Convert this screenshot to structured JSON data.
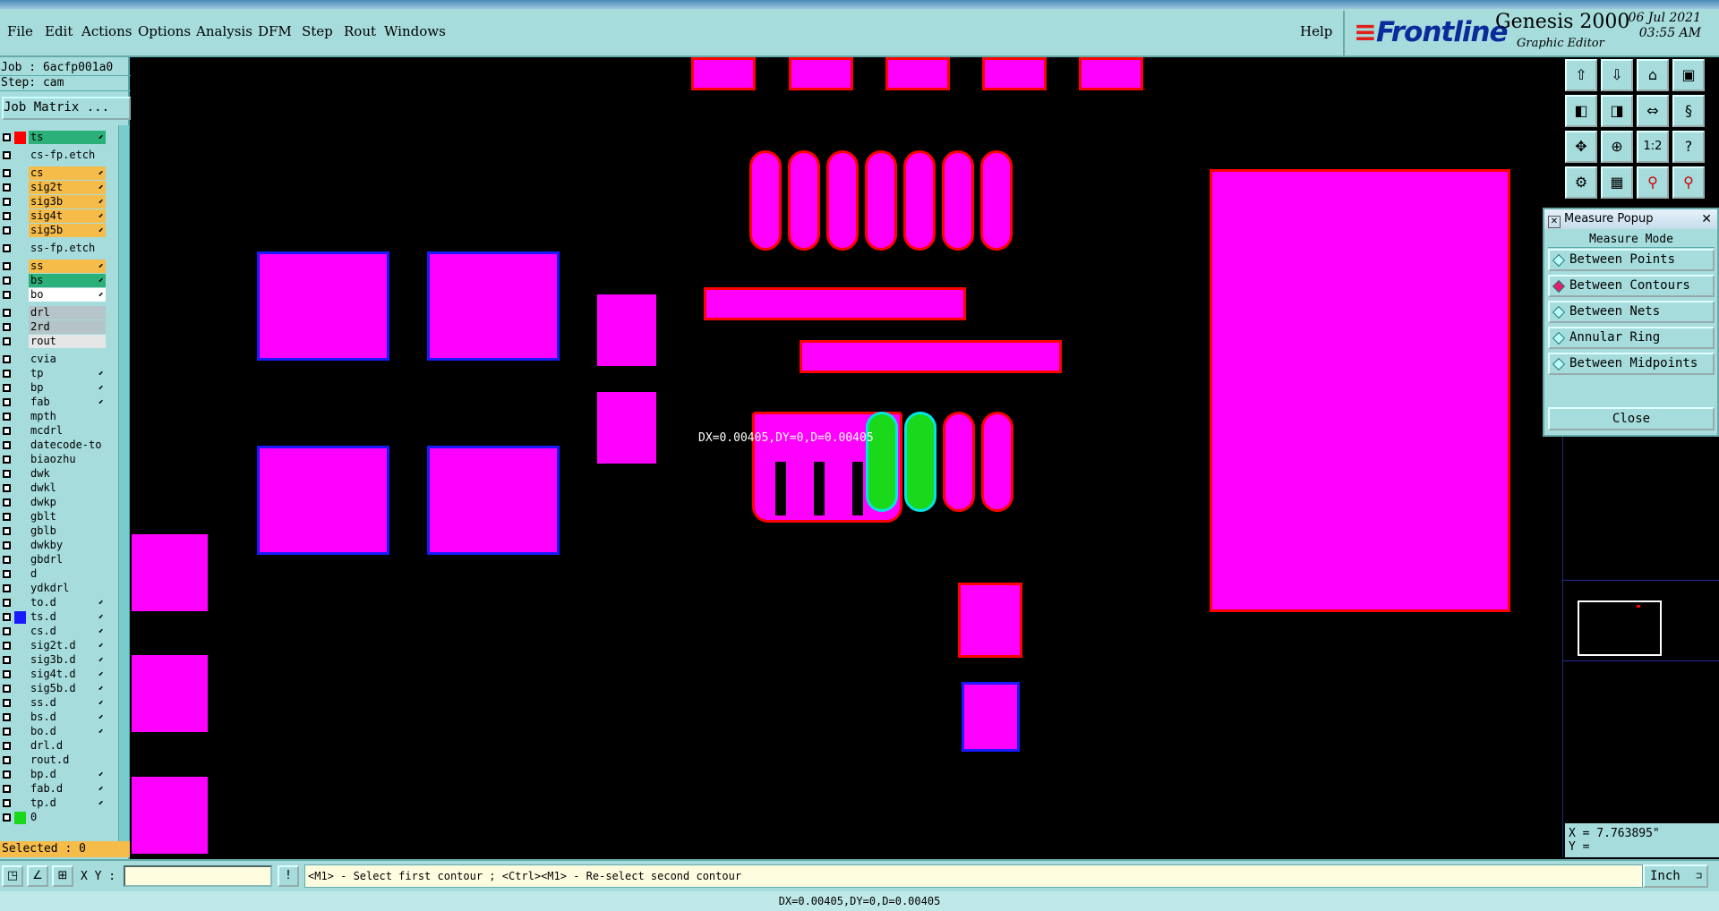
{
  "menu": {
    "items": [
      "File",
      "Edit",
      "Actions",
      "Options",
      "Analysis",
      "DFM",
      "Step",
      "Rout",
      "Windows"
    ],
    "help": "Help"
  },
  "brand": {
    "logo": "Frontline",
    "product": "Genesis 2000",
    "subtitle": "Graphic Editor",
    "date": "06 Jul 2021",
    "time": "03:55 AM"
  },
  "job": {
    "job_label": "Job : 6acfp001a0",
    "step_label": "Step: cam",
    "matrix_button": "Job Matrix ..."
  },
  "layers": [
    {
      "name": "ts",
      "color": "#2bb07a",
      "box": "#ffffff",
      "chip": "#ff0000",
      "arrow": true,
      "fill": "#2bb07a"
    },
    {
      "name": "cs-fp.etch",
      "fill": "#a6dcdc"
    },
    {
      "name": "cs",
      "fill": "#f5bc4a",
      "arrow": true
    },
    {
      "name": "sig2t",
      "fill": "#f5bc4a",
      "arrow": true
    },
    {
      "name": "sig3b",
      "fill": "#f5bc4a",
      "arrow": true
    },
    {
      "name": "sig4t",
      "fill": "#f5bc4a",
      "arrow": true
    },
    {
      "name": "sig5b",
      "fill": "#f5bc4a",
      "arrow": true
    },
    {
      "name": "ss-fp.etch",
      "fill": "#a6dcdc"
    },
    {
      "name": "ss",
      "fill": "#f5bc4a",
      "arrow": true
    },
    {
      "name": "bs",
      "fill": "#2bb07a",
      "arrow": true
    },
    {
      "name": "bo",
      "fill": "#ffffff",
      "arrow": true
    },
    {
      "name": "drl",
      "fill": "#b4c4c8"
    },
    {
      "name": "2rd",
      "fill": "#b4c4c8"
    },
    {
      "name": "rout",
      "fill": "#e6e6e6"
    },
    {
      "name": "cvia",
      "fill": "#a6dcdc"
    },
    {
      "name": "tp",
      "fill": "#a6dcdc",
      "arrow": true
    },
    {
      "name": "bp",
      "fill": "#a6dcdc",
      "arrow": true
    },
    {
      "name": "fab",
      "fill": "#a6dcdc",
      "arrow": true
    },
    {
      "name": "mpth",
      "fill": "#a6dcdc"
    },
    {
      "name": "mcdrl",
      "fill": "#a6dcdc"
    },
    {
      "name": "datecode-to",
      "fill": "#a6dcdc"
    },
    {
      "name": "biaozhu",
      "fill": "#a6dcdc"
    },
    {
      "name": "dwk",
      "fill": "#a6dcdc"
    },
    {
      "name": "dwkl",
      "fill": "#a6dcdc"
    },
    {
      "name": "dwkp",
      "fill": "#a6dcdc"
    },
    {
      "name": "gblt",
      "fill": "#a6dcdc"
    },
    {
      "name": "gblb",
      "fill": "#a6dcdc"
    },
    {
      "name": "dwkby",
      "fill": "#a6dcdc"
    },
    {
      "name": "gbdrl",
      "fill": "#a6dcdc"
    },
    {
      "name": "d",
      "fill": "#a6dcdc"
    },
    {
      "name": "ydkdrl",
      "fill": "#a6dcdc"
    },
    {
      "name": "to.d",
      "fill": "#a6dcdc",
      "arrow": true
    },
    {
      "name": "ts.d",
      "fill": "#a6dcdc",
      "arrow": true,
      "chip": "#1a1aff"
    },
    {
      "name": "cs.d",
      "fill": "#a6dcdc",
      "arrow": true
    },
    {
      "name": "sig2t.d",
      "fill": "#a6dcdc",
      "arrow": true
    },
    {
      "name": "sig3b.d",
      "fill": "#a6dcdc",
      "arrow": true
    },
    {
      "name": "sig4t.d",
      "fill": "#a6dcdc",
      "arrow": true
    },
    {
      "name": "sig5b.d",
      "fill": "#a6dcdc",
      "arrow": true
    },
    {
      "name": "ss.d",
      "fill": "#a6dcdc",
      "arrow": true
    },
    {
      "name": "bs.d",
      "fill": "#a6dcdc",
      "arrow": true
    },
    {
      "name": "bo.d",
      "fill": "#a6dcdc",
      "arrow": true
    },
    {
      "name": "drl.d",
      "fill": "#a6dcdc"
    },
    {
      "name": "rout.d",
      "fill": "#a6dcdc"
    },
    {
      "name": "bp.d",
      "fill": "#a6dcdc",
      "arrow": true
    },
    {
      "name": "fab.d",
      "fill": "#a6dcdc",
      "arrow": true
    },
    {
      "name": "tp.d",
      "fill": "#a6dcdc",
      "arrow": true
    },
    {
      "name": "0",
      "fill": "#a6dcdc",
      "chip": "#1ad81a"
    }
  ],
  "selected": "Selected : 0",
  "canvas": {
    "measure_readout": "DX=0.00405,DY=0,D=0.00405"
  },
  "toolbox": {
    "icons": [
      "layer-up-icon",
      "layer-down-icon",
      "home-icon",
      "window-icon",
      "pan-left-icon",
      "pan-right-icon",
      "zoom-out-icon",
      "zoom-in-icon",
      "fit-icon",
      "center-icon",
      "ratio-label-icon",
      "help-icon",
      "settings-icon",
      "grid-icon",
      "measure-icon",
      "net-icon"
    ],
    "ratio_label": "1:2",
    "help_label": "?"
  },
  "measure_popup": {
    "title": "Measure Popup",
    "heading": "Measure Mode",
    "options": [
      {
        "label": "Between Points",
        "selected": false
      },
      {
        "label": "Between Contours",
        "selected": true
      },
      {
        "label": "Between Nets",
        "selected": false
      },
      {
        "label": "Annular Ring",
        "selected": false
      },
      {
        "label": "Between Midpoints",
        "selected": false
      }
    ],
    "close_label": "Close"
  },
  "coords": {
    "x": "X = 7.763895\"",
    "y": "Y ="
  },
  "bottom": {
    "xy_label": "X Y :",
    "xy_value": "",
    "prompt": "<M1> - Select first contour ; <Ctrl><M1> - Re-select second contour",
    "units": "Inch",
    "status": "DX=0.00405,DY=0,D=0.00405"
  },
  "colors": {
    "panel": "#a6dcdc",
    "pad_fill": "#ff00ff",
    "pad_outline_red": "#ff0000",
    "pad_outline_blue": "#1a1aff",
    "selected_contour": "#1ad81a",
    "selected_outline": "#00e5e5"
  }
}
